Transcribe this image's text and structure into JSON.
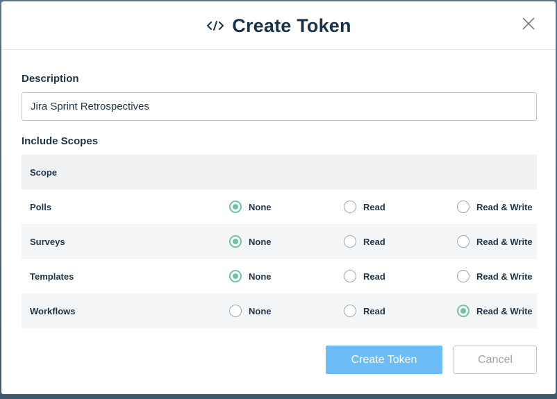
{
  "modal": {
    "title": "Create Token",
    "title_icon": "code-icon",
    "close_icon": "close-icon"
  },
  "description": {
    "label": "Description",
    "value": "Jira Sprint Retrospectives"
  },
  "scopes": {
    "label": "Include Scopes",
    "column_header": "Scope",
    "options": [
      "None",
      "Read",
      "Read & Write"
    ],
    "rows": [
      {
        "name": "Polls",
        "selected": "None"
      },
      {
        "name": "Surveys",
        "selected": "None"
      },
      {
        "name": "Templates",
        "selected": "None"
      },
      {
        "name": "Workflows",
        "selected": "Read & Write"
      }
    ]
  },
  "actions": {
    "create_label": "Create Token",
    "cancel_label": "Cancel"
  },
  "colors": {
    "accent_radio": "#6cc4a4",
    "primary_button": "#6cbdf5",
    "title_text": "#17324a"
  }
}
